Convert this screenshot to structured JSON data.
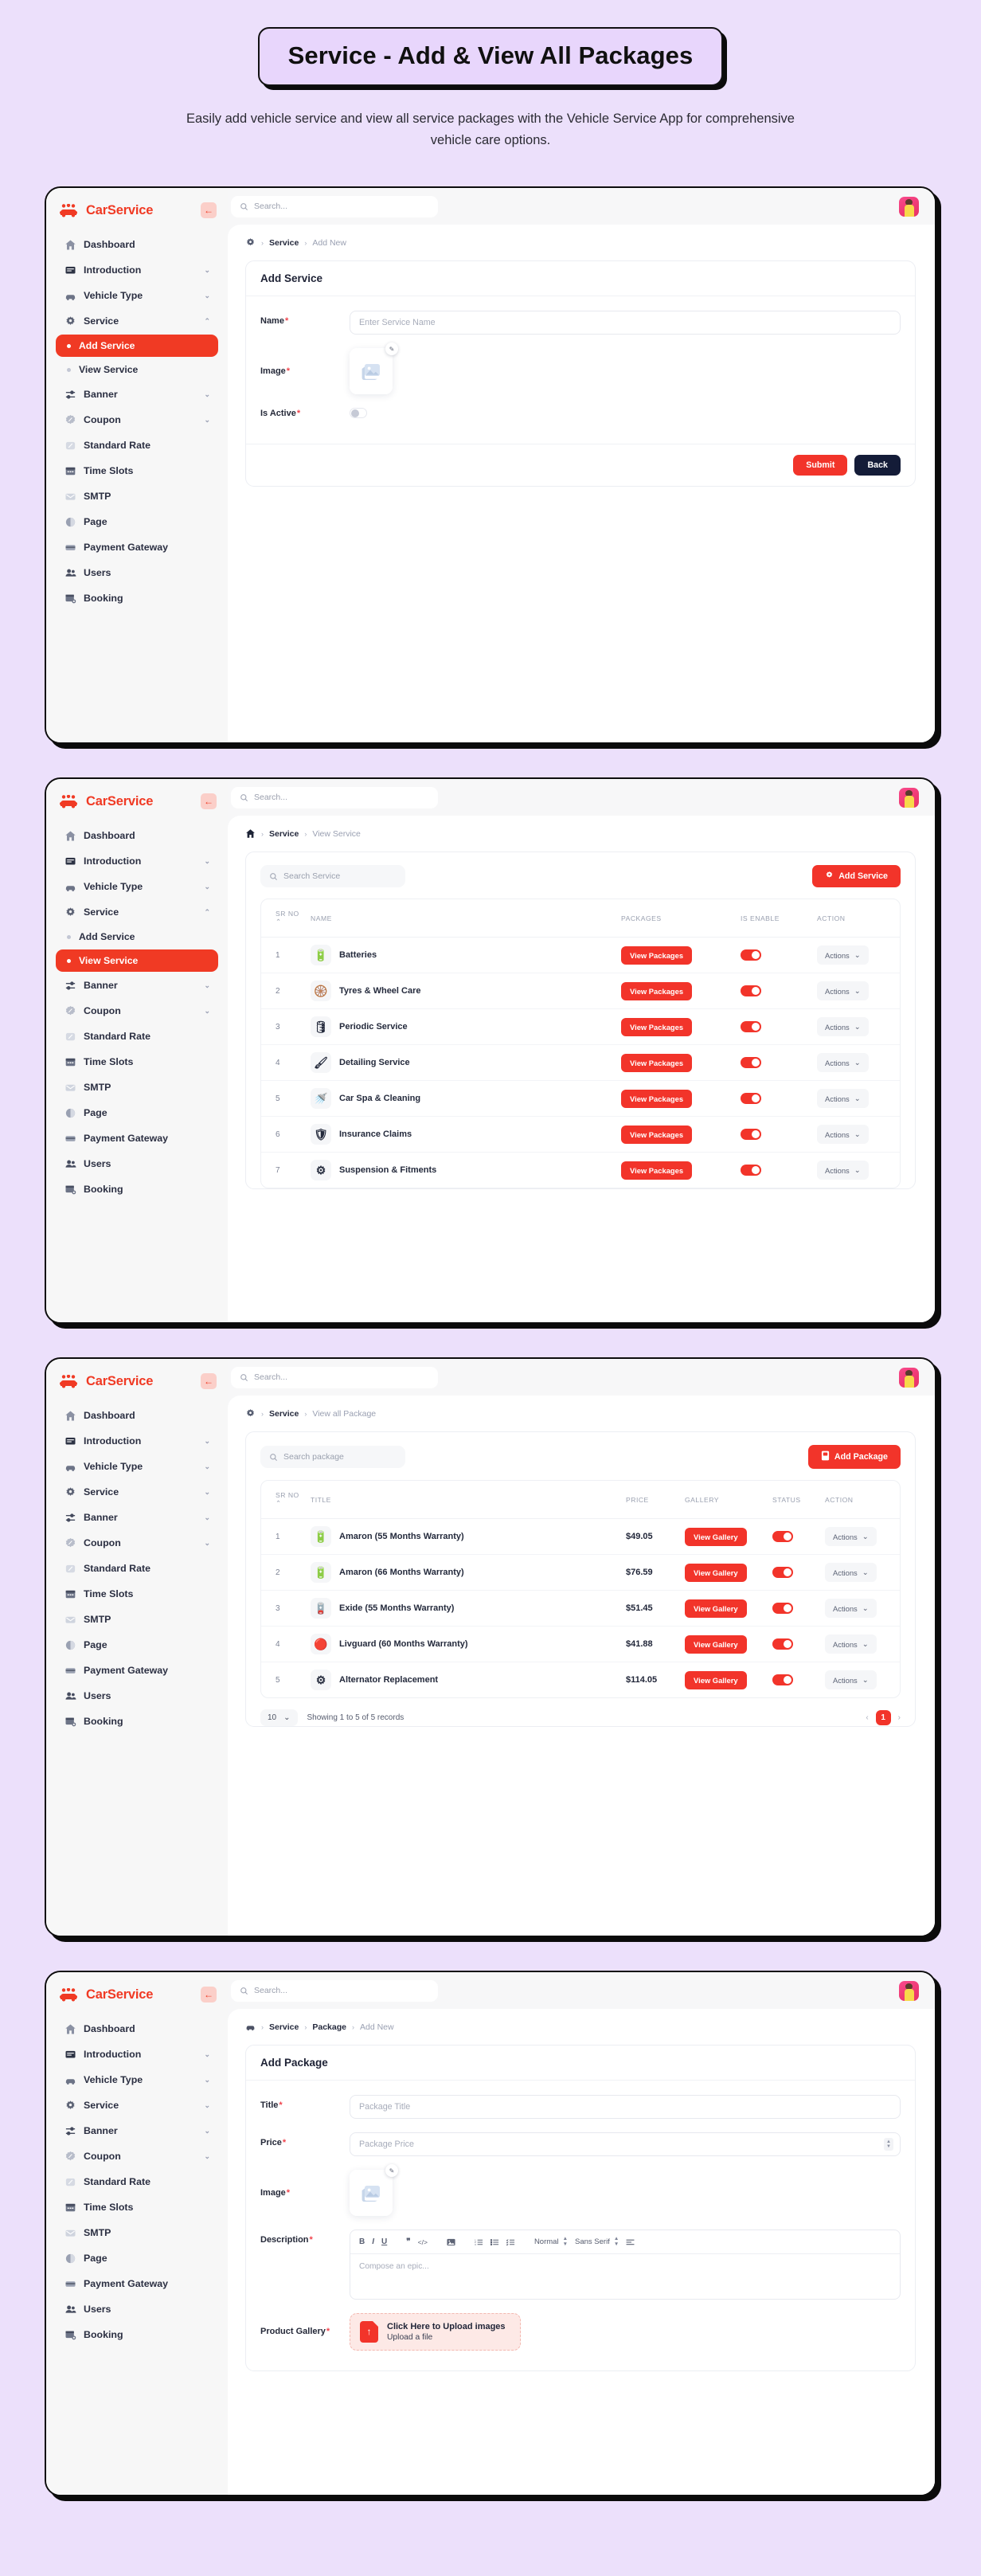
{
  "hero": {
    "title": "Service - Add & View All Packages",
    "subtitle": "Easily add vehicle service and view all service packages with the Vehicle Service App for comprehensive vehicle care options."
  },
  "brand": {
    "name": "CarService",
    "collapse_icon": "arrow-left-icon"
  },
  "topbar": {
    "search_placeholder": "Search...",
    "avatar": "user-avatar"
  },
  "sidebar": {
    "items": [
      {
        "label": "Dashboard",
        "icon": "home-icon",
        "chevron": false
      },
      {
        "label": "Introduction",
        "icon": "book-icon",
        "chevron": true
      },
      {
        "label": "Vehicle Type",
        "icon": "car-icon",
        "chevron": true
      },
      {
        "label": "Service",
        "icon": "gear-icon",
        "chevron": true
      },
      {
        "label": "Banner",
        "icon": "sliders-icon",
        "chevron": true
      },
      {
        "label": "Coupon",
        "icon": "discount-icon",
        "chevron": true
      },
      {
        "label": "Standard Rate",
        "icon": "percent-icon",
        "chevron": false
      },
      {
        "label": "Time Slots",
        "icon": "calendar-icon",
        "chevron": false
      },
      {
        "label": "SMTP",
        "icon": "mail-icon",
        "chevron": false
      },
      {
        "label": "Page",
        "icon": "page-icon",
        "chevron": false
      },
      {
        "label": "Payment Gateway",
        "icon": "card-icon",
        "chevron": false
      },
      {
        "label": "Users",
        "icon": "users-icon",
        "chevron": false
      },
      {
        "label": "Booking",
        "icon": "booking-icon",
        "chevron": false
      }
    ],
    "service_sub": [
      {
        "label": "Add Service"
      },
      {
        "label": "View Service"
      }
    ]
  },
  "panel1": {
    "breadcrumb": {
      "icon": "gear-icon",
      "parent": "Service",
      "current": "Add New"
    },
    "card_title": "Add Service",
    "fields": {
      "name_label": "Name",
      "name_placeholder": "Enter Service Name",
      "image_label": "Image",
      "image_icon": "image-placeholder-icon",
      "edit_icon": "pencil-icon",
      "is_active_label": "Is Active"
    },
    "submit_label": "Submit",
    "back_label": "Back"
  },
  "panel2": {
    "breadcrumb": {
      "icon": "home-icon",
      "parent": "Service",
      "current": "View Service"
    },
    "search_placeholder": "Search Service",
    "add_button": "Add Service",
    "add_button_icon": "gear-icon",
    "columns": [
      "SR NO",
      "NAME",
      "PACKAGES",
      "IS ENABLE",
      "ACTION"
    ],
    "sort_icon": "chevron-up-icon",
    "package_btn_label": "View Packages",
    "action_btn_label": "Actions",
    "rows": [
      {
        "sr": "1",
        "name": "Batteries",
        "icon": "🔋",
        "enabled": true
      },
      {
        "sr": "2",
        "name": "Tyres & Wheel Care",
        "icon": "🛞",
        "enabled": true
      },
      {
        "sr": "3",
        "name": "Periodic Service",
        "icon": "🛢",
        "enabled": true
      },
      {
        "sr": "4",
        "name": "Detailing Service",
        "icon": "🖌",
        "enabled": true
      },
      {
        "sr": "5",
        "name": "Car Spa & Cleaning",
        "icon": "🚿",
        "enabled": true
      },
      {
        "sr": "6",
        "name": "Insurance Claims",
        "icon": "🛡",
        "enabled": true
      },
      {
        "sr": "7",
        "name": "Suspension & Fitments",
        "icon": "⚙",
        "enabled": true
      }
    ]
  },
  "panel3": {
    "breadcrumb": {
      "icon": "gear-icon",
      "parent": "Service",
      "current": "View all Package"
    },
    "search_placeholder": "Search package",
    "add_button": "Add Package",
    "add_button_icon": "package-icon",
    "columns": [
      "SR NO",
      "TITLE",
      "PRICE",
      "GALLERY",
      "STATUS",
      "ACTION"
    ],
    "gallery_btn_label": "View Gallery",
    "action_btn_label": "Actions",
    "rows": [
      {
        "sr": "1",
        "title": "Amaron (55 Months Warranty)",
        "price": "$49.05",
        "icon": "🔋",
        "enabled": true
      },
      {
        "sr": "2",
        "title": "Amaron (66 Months Warranty)",
        "price": "$76.59",
        "icon": "🔋",
        "enabled": true
      },
      {
        "sr": "3",
        "title": "Exide (55 Months Warranty)",
        "price": "$51.45",
        "icon": "🪫",
        "enabled": true
      },
      {
        "sr": "4",
        "title": "Livguard (60 Months Warranty)",
        "price": "$41.88",
        "icon": "🔴",
        "enabled": true
      },
      {
        "sr": "5",
        "title": "Alternator Replacement",
        "price": "$114.05",
        "icon": "⚙",
        "enabled": true
      }
    ],
    "pagination": {
      "page_size": "10",
      "showing": "Showing 1 to 5 of 5 records",
      "prev_icon": "chevron-left-icon",
      "next_icon": "chevron-right-icon",
      "current_page": "1"
    }
  },
  "panel4": {
    "breadcrumb": {
      "icon": "car-icon",
      "parent": "Service",
      "middle": "Package",
      "current": "Add New"
    },
    "card_title": "Add Package",
    "fields": {
      "title_label": "Title",
      "title_placeholder": "Package Title",
      "price_label": "Price",
      "price_placeholder": "Package Price",
      "image_label": "Image",
      "description_label": "Description",
      "description_placeholder": "Compose an epic...",
      "gallery_label": "Product Gallery"
    },
    "editor_toolbar": {
      "bold": "B",
      "italic": "I",
      "underline": "U",
      "quote": "❞",
      "code": "</>",
      "image": "image-icon",
      "ol": "ordered-list-icon",
      "ul": "bullet-list-icon",
      "check": "check-list-icon",
      "heading": "Normal",
      "font": "Sans Serif",
      "align": "align-icon"
    },
    "upload": {
      "title": "Click Here to Upload images",
      "subtitle": "Upload a file",
      "icon": "upload-file-icon"
    }
  }
}
